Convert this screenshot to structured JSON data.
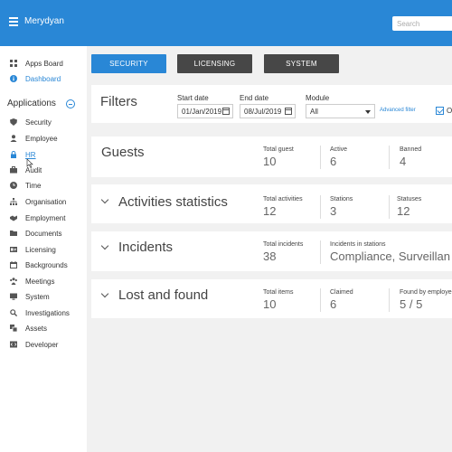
{
  "app": {
    "title": "Merydyan"
  },
  "search": {
    "placeholder": "Search"
  },
  "sidebar": {
    "top_items": [
      {
        "label": "Apps Board",
        "icon": "grid-icon"
      },
      {
        "label": "Dashboard",
        "icon": "info-icon",
        "active": true
      }
    ],
    "section_title": "Applications",
    "items": [
      {
        "label": "Security",
        "icon": "shield-icon"
      },
      {
        "label": "Employee",
        "icon": "person-icon"
      },
      {
        "label": "HR",
        "icon": "lock-icon",
        "active": true
      },
      {
        "label": "Audit",
        "icon": "briefcase-icon"
      },
      {
        "label": "Time",
        "icon": "clock-icon"
      },
      {
        "label": "Organisation",
        "icon": "org-chart-icon"
      },
      {
        "label": "Employment",
        "icon": "handshake-icon"
      },
      {
        "label": "Documents",
        "icon": "folder-icon"
      },
      {
        "label": "Licensing",
        "icon": "id-card-icon"
      },
      {
        "label": "Backgrounds",
        "icon": "calendar-icon"
      },
      {
        "label": "Meetings",
        "icon": "people-icon"
      },
      {
        "label": "System",
        "icon": "monitor-icon"
      },
      {
        "label": "Investigations",
        "icon": "magnifier-icon"
      },
      {
        "label": "Assets",
        "icon": "assets-icon"
      },
      {
        "label": "Developer",
        "icon": "code-icon"
      }
    ]
  },
  "tabs": [
    {
      "label": "SECURITY",
      "active": true
    },
    {
      "label": "LICENSING",
      "active": false
    },
    {
      "label": "SYSTEM",
      "active": false
    }
  ],
  "filters": {
    "title": "Filters",
    "start_date_label": "Start date",
    "start_date_value": "01/Jan/2019",
    "end_date_label": "End date",
    "end_date_value": "08/Jul/2019",
    "module_label": "Module",
    "module_value": "All",
    "advanced_link": "Advanced filter",
    "checkbox_label": "O",
    "checkbox_checked": true
  },
  "cards": [
    {
      "title": "Guests",
      "stats": [
        {
          "label": "Total guest",
          "value": "10"
        },
        {
          "label": "Active",
          "value": "6"
        },
        {
          "label": "Banned",
          "value": "4"
        }
      ]
    },
    {
      "title": "Activities statistics",
      "stats": [
        {
          "label": "Total activities",
          "value": "12"
        },
        {
          "label": "Stations",
          "value": "3"
        },
        {
          "label": "Statuses",
          "value": "12"
        }
      ]
    },
    {
      "title": "Incidents",
      "stats": [
        {
          "label": "Total incidents",
          "value": "38"
        },
        {
          "label": "Incidents in stations",
          "value": "Compliance, Surveillan"
        }
      ]
    },
    {
      "title": "Lost and found",
      "stats": [
        {
          "label": "Total items",
          "value": "10"
        },
        {
          "label": "Claimed",
          "value": "6"
        },
        {
          "label": "Found by employe",
          "value": "5 / 5"
        }
      ]
    }
  ],
  "colors": {
    "primary": "#2987d6",
    "tab_inactive": "#474747",
    "background": "#f1f1f1"
  }
}
